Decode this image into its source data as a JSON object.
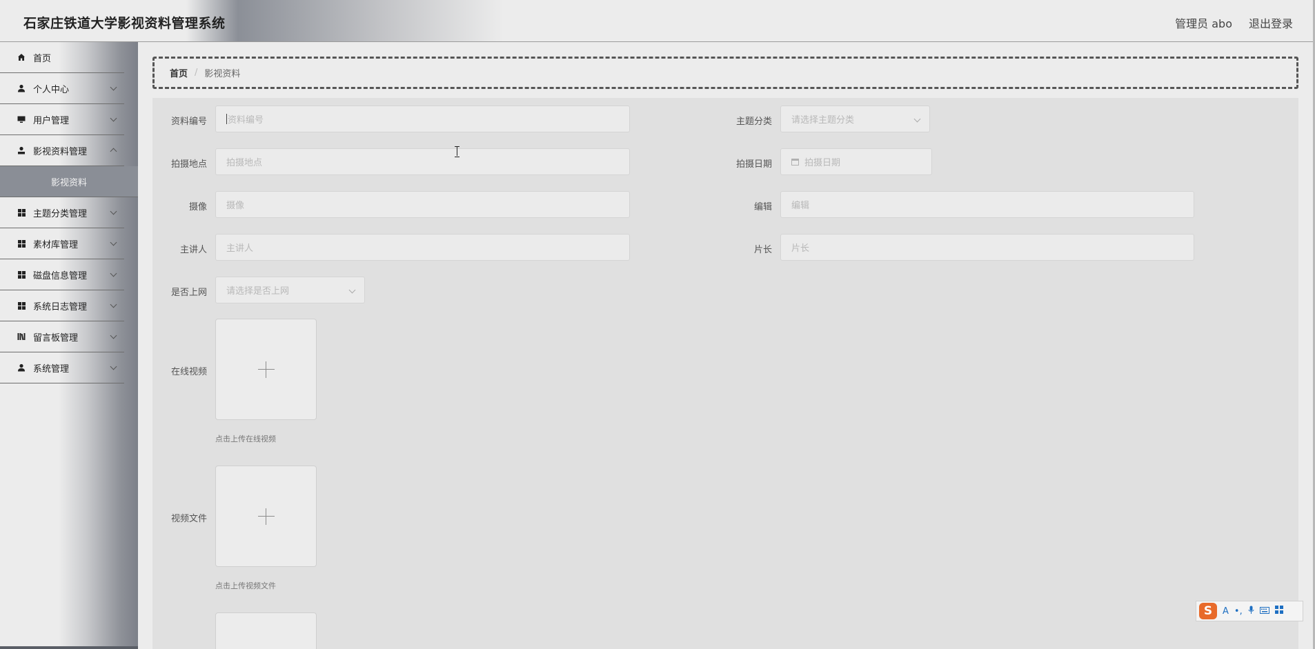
{
  "header": {
    "title": "石家庄铁道大学影视资料管理系统",
    "user_label": "管理员 abo",
    "logout_label": "退出登录"
  },
  "sidebar": {
    "items": [
      {
        "label": "首页",
        "icon": "home-icon"
      },
      {
        "label": "个人中心",
        "icon": "user-icon"
      },
      {
        "label": "用户管理",
        "icon": "monitor-icon"
      },
      {
        "label": "影视资料管理",
        "icon": "user-icon"
      },
      {
        "label": "主题分类管理",
        "icon": "grid-icon"
      },
      {
        "label": "素材库管理",
        "icon": "grid-icon"
      },
      {
        "label": "磁盘信息管理",
        "icon": "grid-icon"
      },
      {
        "label": "系统日志管理",
        "icon": "grid-icon"
      },
      {
        "label": "留言板管理",
        "icon": "library-icon"
      },
      {
        "label": "系统管理",
        "icon": "user-icon"
      }
    ],
    "active_sub": "影视资料"
  },
  "breadcrumb": {
    "home": "首页",
    "separator": "/",
    "current": "影视资料"
  },
  "form": {
    "ziliao_bianhao": {
      "label": "资料编号",
      "placeholder": "资料编号",
      "value": ""
    },
    "zhuti_fenlei": {
      "label": "主题分类",
      "placeholder": "请选择主题分类",
      "value": ""
    },
    "paishe_didian": {
      "label": "拍摄地点",
      "placeholder": "拍摄地点",
      "value": ""
    },
    "paishe_riqi": {
      "label": "拍摄日期",
      "placeholder": "拍摄日期",
      "value": ""
    },
    "shexiang": {
      "label": "摄像",
      "placeholder": "摄像",
      "value": ""
    },
    "bianji": {
      "label": "编辑",
      "placeholder": "编辑",
      "value": ""
    },
    "zhujiangren": {
      "label": "主讲人",
      "placeholder": "主讲人",
      "value": ""
    },
    "pianchang": {
      "label": "片长",
      "placeholder": "片长",
      "value": ""
    },
    "shifou_shangwang": {
      "label": "是否上网",
      "placeholder": "请选择是否上网",
      "value": ""
    },
    "zaixian_shipin": {
      "label": "在线视频",
      "hint": "点击上传在线视频"
    },
    "shipin_wenjian": {
      "label": "视频文件",
      "hint": "点击上传视频文件"
    }
  },
  "ime_toolbar": {
    "logo": "S",
    "lang": "A",
    "punct": "•,"
  },
  "colors": {
    "sidebar_active": "#8a8e96",
    "ime_logo": "#e86a2a"
  }
}
